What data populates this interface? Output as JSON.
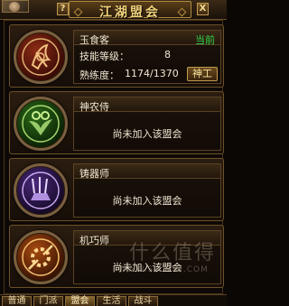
{
  "header": {
    "title": "江湖盟会",
    "help_label": "?",
    "close_label": "X"
  },
  "professions": [
    {
      "name": "玉食客",
      "status": "当前",
      "skill_level_label": "技能等级：",
      "skill_level_value": "8",
      "proficiency_label": "熟练度：",
      "proficiency_value": "1174/1370",
      "action_label": "神工",
      "icon": "chef-medal-icon",
      "accent_color": "#c04a2a"
    },
    {
      "name": "神农侍",
      "status_text": "尚未加入该盟会",
      "icon": "herb-medal-icon",
      "accent_color": "#4fa83a"
    },
    {
      "name": "铸器师",
      "status_text": "尚未加入该盟会",
      "icon": "forge-medal-icon",
      "accent_color": "#8a5ac8"
    },
    {
      "name": "机巧师",
      "status_text": "尚未加入该盟会",
      "icon": "gear-medal-icon",
      "accent_color": "#e08a20"
    }
  ],
  "watermark": {
    "text": "什么值得",
    "url": "WWW.SMZDM.COM"
  },
  "tabs": [
    {
      "label": "普通",
      "active": false
    },
    {
      "label": "门派",
      "active": false
    },
    {
      "label": "盟会",
      "active": true
    },
    {
      "label": "生活",
      "active": false
    },
    {
      "label": "战斗",
      "active": false
    }
  ]
}
